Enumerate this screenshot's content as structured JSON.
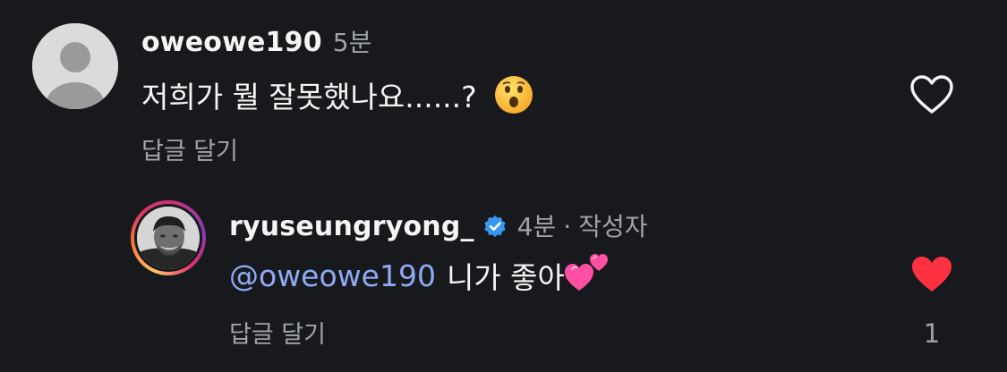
{
  "comments": [
    {
      "username": "oweowe190",
      "time": "5분",
      "text": "저희가 뭘 잘못했나요......?",
      "emoji": "hushed-face",
      "reply_label": "답글 달기",
      "liked": false
    },
    {
      "username": "ryuseungryong_",
      "verified": true,
      "time": "4분",
      "separator": "·",
      "author_label": "작성자",
      "mention": "@oweowe190",
      "text": "니가 좋아",
      "emoji": "two-hearts",
      "reply_label": "답글 달기",
      "liked": true,
      "like_count": "1"
    }
  ],
  "colors": {
    "background": "#17191c",
    "primary_text": "#f5f5f5",
    "secondary_text": "#a0a3a8",
    "mention": "#8fa9f5",
    "like_active": "#ff3040",
    "verified": "#3897f0"
  }
}
